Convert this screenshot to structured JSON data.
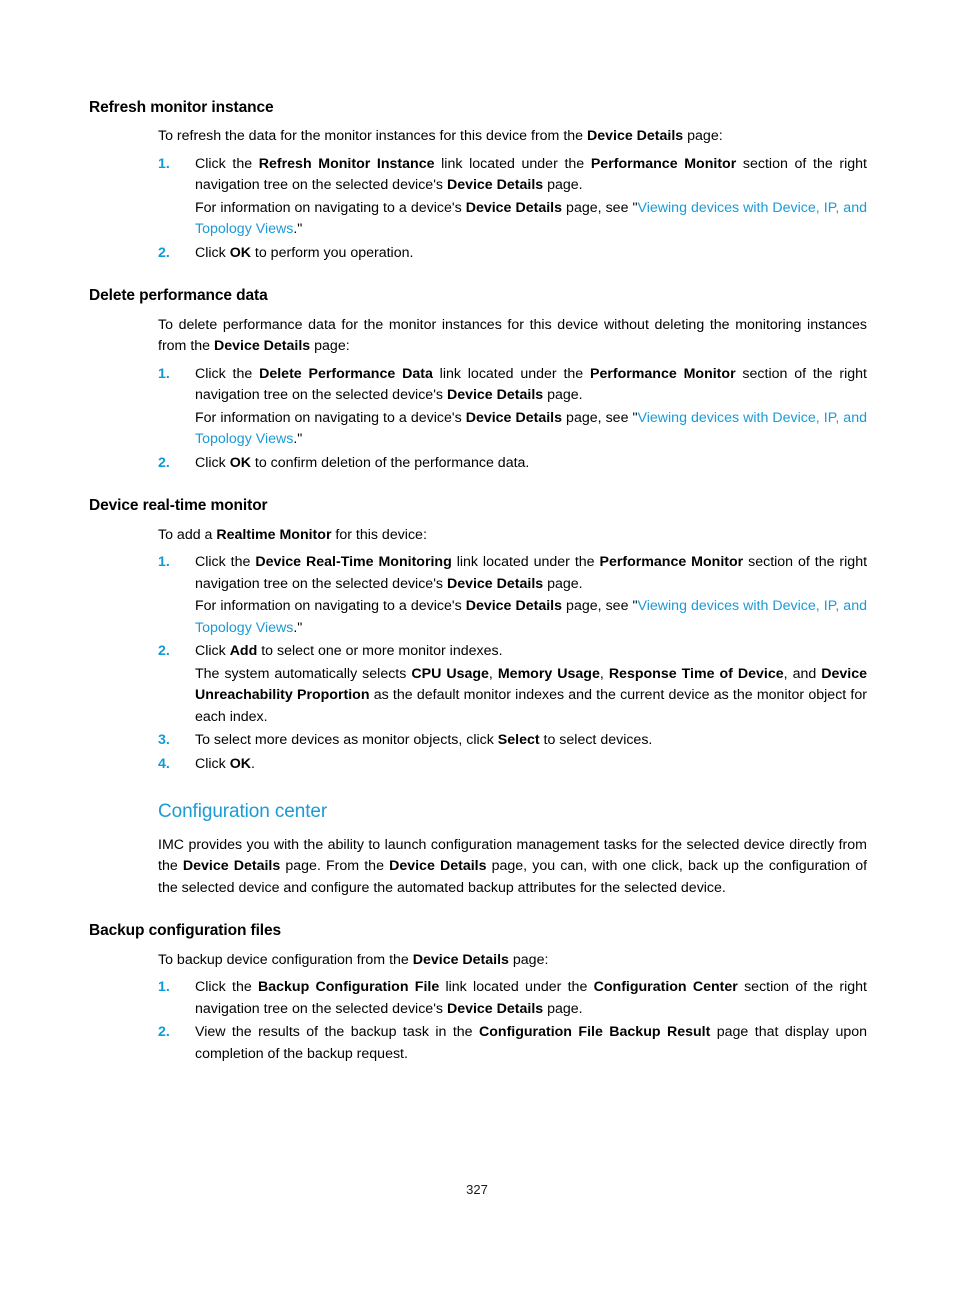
{
  "document": {
    "page_number": "327",
    "link_color": "#1b9ad6",
    "step_number_color": "#0f9bd7",
    "heading_color": "#000000"
  },
  "xref": {
    "label_part1": "Viewing devices with Device,",
    "label_part2": "IP, and Topology Views"
  },
  "sections": [
    {
      "heading": "Refresh monitor instance",
      "intro_a": "To refresh the data for the monitor instances for this device from the ",
      "intro_b": "Device Details",
      "intro_c": " page:",
      "steps": [
        {
          "num": "1.",
          "t1": "Click the ",
          "b1": "Refresh Monitor Instance",
          "t2": " link located under the ",
          "b2": "Performance Monitor",
          "t3": " section of the right navigation tree on the selected device's ",
          "b3": "Device Details",
          "t4": " page.",
          "note_t1": "For information on navigating to a device's ",
          "note_b1": "Device Details",
          "note_t2": " page, see \"",
          "note_t3": ".\""
        },
        {
          "num": "2.",
          "t1": "Click ",
          "b1": "OK",
          "t2": " to perform you operation."
        }
      ]
    },
    {
      "heading": "Delete performance data",
      "intro_a": "To delete performance data for the monitor instances for this device without deleting the monitoring instances from the ",
      "intro_b": "Device Details",
      "intro_c": " page:",
      "steps": [
        {
          "num": "1.",
          "t1": "Click the ",
          "b1": "Delete Performance Data",
          "t2": " link located under the ",
          "b2": "Performance Monitor",
          "t3": " section of the right navigation tree on the selected device's ",
          "b3": "Device Details",
          "t4": " page.",
          "note_t1": "For information on navigating to a device's ",
          "note_b1": "Device Details",
          "note_t2": " page, see \"",
          "note_t3": ".\""
        },
        {
          "num": "2.",
          "t1": "Click ",
          "b1": "OK",
          "t2": " to confirm deletion of the performance data."
        }
      ]
    },
    {
      "heading": "Device real-time monitor",
      "intro_a": "To add a ",
      "intro_b": "Realtime Monitor",
      "intro_c": " for this device:",
      "steps": [
        {
          "num": "1.",
          "t1": "Click the ",
          "b1": "Device Real-Time Monitoring",
          "t2": " link located under the ",
          "b2": "Performance Monitor",
          "t3": " section of the right navigation tree on the selected device's ",
          "b3": "Device Details",
          "t4": " page.",
          "note_t1": "For information on navigating to a device's ",
          "note_b1": "Device Details",
          "note_t2": " page, see \"",
          "note_t3": ".\""
        },
        {
          "num": "2.",
          "t1": "Click ",
          "b1": "Add",
          "t2": " to select one or more monitor indexes.",
          "note2_t1": "The system automatically selects ",
          "note2_b1": "CPU Usage",
          "note2_t2": ", ",
          "note2_b2": "Memory Usage",
          "note2_t3": ", ",
          "note2_b3": "Response Time of Device",
          "note2_t4": ", and ",
          "note2_b4": "Device Unreachability Proportion",
          "note2_t5": " as the default monitor indexes and the current device as the monitor object for each index."
        },
        {
          "num": "3.",
          "t1": "To select more devices as monitor objects, click ",
          "b1": "Select",
          "t2": " to select devices."
        },
        {
          "num": "4.",
          "t1": "Click ",
          "b1": "OK",
          "t2": "."
        }
      ]
    }
  ],
  "config_center": {
    "heading": "Configuration center",
    "para_t1": "IMC provides you with the ability to launch configuration management tasks for the selected device directly from the ",
    "para_b1": "Device Details",
    "para_t2": " page. From the ",
    "para_b2": "Device Details",
    "para_t3": " page, you can, with one click, back up the configuration of the selected device and configure the automated backup attributes for the selected device."
  },
  "backup_section": {
    "heading": "Backup configuration files",
    "intro_a": "To backup device configuration from the ",
    "intro_b": "Device Details",
    "intro_c": " page:",
    "steps": [
      {
        "num": "1.",
        "t1": "Click the ",
        "b1": "Backup Configuration File",
        "t2": " link located under the ",
        "b2": "Configuration Center",
        "t3": " section of the right navigation tree on the selected device's ",
        "b3": "Device Details",
        "t4": " page."
      },
      {
        "num": "2.",
        "t1": "View the results of the backup task in the ",
        "b1": "Configuration File Backup Result",
        "t2": " page that display upon completion of the backup request."
      }
    ]
  }
}
